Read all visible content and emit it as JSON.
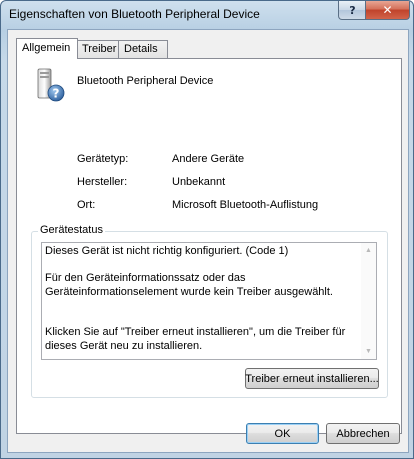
{
  "window": {
    "title": "Eigenschaften von Bluetooth Peripheral Device"
  },
  "titlebar": {
    "help_label": "?",
    "close_label": "✕"
  },
  "tabs": [
    {
      "label": "Allgemein",
      "active": true
    },
    {
      "label": "Treiber",
      "active": false
    },
    {
      "label": "Details",
      "active": false
    }
  ],
  "device": {
    "name": "Bluetooth Peripheral Device",
    "icon": "unknown-device-icon"
  },
  "properties": [
    {
      "label": "Gerätetyp:",
      "value": "Andere Geräte"
    },
    {
      "label": "Hersteller:",
      "value": "Unbekannt"
    },
    {
      "label": "Ort:",
      "value": "Microsoft Bluetooth-Auflistung"
    }
  ],
  "status": {
    "group_title": "Gerätestatus",
    "line1": "Dieses Gerät ist nicht richtig konfiguriert. (Code 1)",
    "line2": "Für den Geräteinformationssatz oder das Geräteinformationselement wurde kein Treiber ausgewählt.",
    "line3": "Klicken Sie auf \"Treiber erneut installieren\", um die Treiber für dieses Gerät neu zu installieren.",
    "reinstall_button": "Treiber erneut installieren..."
  },
  "buttons": {
    "ok": "OK",
    "cancel": "Abbrechen"
  }
}
